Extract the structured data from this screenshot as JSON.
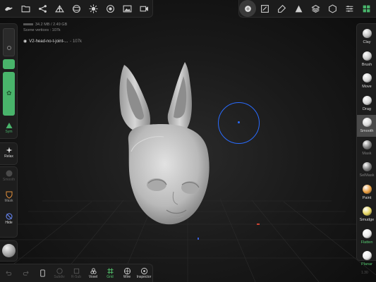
{
  "stats": {
    "memory": "34.2 MB / 2.49 GB",
    "scene_vertices": "Scene vertices : 107k"
  },
  "mesh": {
    "name": "V2-head-no-t-joint-...",
    "count": "- 107k"
  },
  "top_left_icons": [
    "logo-icon",
    "folder-icon",
    "scene-graph-icon",
    "topology-icon",
    "sphere-icon",
    "light-icon",
    "material-icon",
    "image-icon",
    "camera-icon"
  ],
  "top_right_icons": [
    "brush-settings-icon",
    "stroke-icon",
    "painting-icon",
    "topology-tool-icon",
    "layers-icon",
    "scene-icon",
    "settings-icon",
    "interface-icon"
  ],
  "left_panel": {
    "sym_label": "Sym",
    "relax_label": "Relax",
    "smooth_label": "Smooth",
    "mask_label": "Mask",
    "hide_label": "Hide"
  },
  "tools": [
    {
      "label": "Clay",
      "color": "#bdbdbd",
      "state": "normal"
    },
    {
      "label": "Brush",
      "color": "#c8c8c8",
      "state": "normal"
    },
    {
      "label": "Move",
      "color": "#d2d2d2",
      "state": "normal"
    },
    {
      "label": "Drag",
      "color": "#d2d2d2",
      "state": "normal"
    },
    {
      "label": "Smooth",
      "color": "#d8d8d8",
      "state": "active"
    },
    {
      "label": "Mask",
      "color": "#777777",
      "state": "dim"
    },
    {
      "label": "SelMask",
      "color": "#777777",
      "state": "dim"
    },
    {
      "label": "Paint",
      "color": "#e89a3a",
      "state": "normal"
    },
    {
      "label": "Smudge",
      "color": "#e2d25a",
      "state": "normal"
    },
    {
      "label": "Flatten",
      "color": "#e8e8e8",
      "state": "green"
    },
    {
      "label": "Planar",
      "color": "#e8e8e8",
      "state": "green"
    }
  ],
  "bottom": {
    "undo": "",
    "redo": "",
    "voxel": "Voxel",
    "grid": "Grid",
    "wire": "Wire",
    "inspector": "Inspector",
    "subdiv": "Subdiv",
    "rebuild": "R-Sub"
  },
  "fps": "1.30",
  "colors": {
    "accent_green": "#49b46b",
    "cursor_blue": "#2a6cff"
  }
}
